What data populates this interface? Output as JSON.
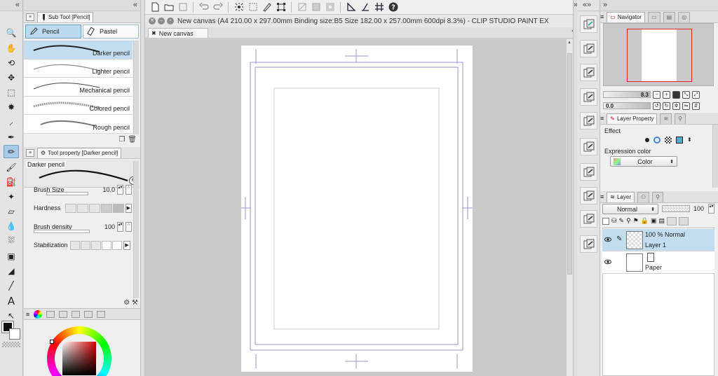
{
  "app": {
    "title": "New canvas (A4 210.00 x 297.00mm Binding size:B5 Size 182.00 x 257.00mm 600dpi 8.3%)  - CLIP STUDIO PAINT EX",
    "document_tab": "New canvas",
    "collapse_left": "«",
    "collapse_right": "»",
    "collapse_right2": "«»"
  },
  "tools": [
    {
      "name": "zoom-icon"
    },
    {
      "name": "hand-icon"
    },
    {
      "name": "rotate-icon"
    },
    {
      "name": "move-layer-icon"
    },
    {
      "name": "selection-icon"
    },
    {
      "name": "auto-select-icon"
    },
    {
      "name": "eyedropper-icon"
    },
    {
      "name": "pen-icon"
    },
    {
      "name": "pencil-icon"
    },
    {
      "name": "brush-icon"
    },
    {
      "name": "airbrush-icon"
    },
    {
      "name": "decoration-icon"
    },
    {
      "name": "eraser-icon"
    },
    {
      "name": "blend-icon"
    },
    {
      "name": "fill-icon"
    },
    {
      "name": "gradient-icon"
    },
    {
      "name": "figure-icon"
    },
    {
      "name": "line-icon"
    },
    {
      "name": "text-icon"
    },
    {
      "name": "operation-icon"
    }
  ],
  "subtool": {
    "panel_title": "Sub Tool [Pencil]",
    "groups": [
      "Pencil",
      "Pastel"
    ],
    "brushes": [
      "Darker pencil",
      "Lighter pencil",
      "Mechanical pencil",
      "Colored pencil",
      "Rough pencil"
    ]
  },
  "toolprop": {
    "panel_title": "Tool property [Darker pencil]",
    "preview_label": "Darker pencil",
    "brush_size_label": "Brush Size",
    "brush_size_value": "10.0",
    "hardness_label": "Hardness",
    "density_label": "Brush density",
    "density_value": "100",
    "stabilization_label": "Stabilization"
  },
  "navigator": {
    "tab": "Navigator",
    "zoom_value": "8.3",
    "rotate_value": "0.0"
  },
  "layer_property": {
    "tab": "Layer Property",
    "effect_label": "Effect",
    "expression_label": "Expression color",
    "expression_value": "Color"
  },
  "layers": {
    "tab": "Layer",
    "blend_mode": "Normal",
    "opacity": "100",
    "items": [
      {
        "line1": "100 % Normal",
        "line2": "Layer 1",
        "active": true
      },
      {
        "line1": "",
        "line2": "Paper",
        "active": false
      }
    ]
  },
  "colors": {
    "accent": "#a8cce6",
    "selection": "#c2dcf0",
    "nav_frame": "#e02020",
    "canvas_bg": "#c9c9c9",
    "guide": "#9494cc"
  }
}
